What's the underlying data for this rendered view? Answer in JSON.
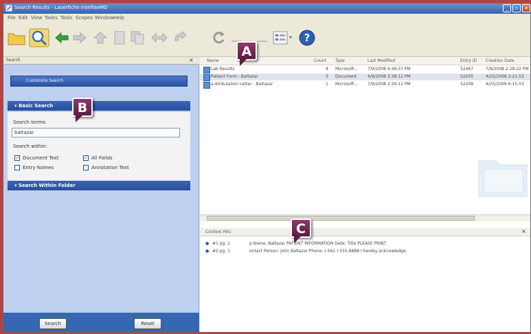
{
  "window": {
    "title": "Search Results - Laserfiche IntelliseMD"
  },
  "menu": [
    "File",
    "Edit",
    "View",
    "Tasks",
    "Tools",
    "Scopes",
    "Window",
    "Help"
  ],
  "search_pane": {
    "header": "Search",
    "customize_label": "Customize Search",
    "basic_search": {
      "title": "Basic Search",
      "terms_label": "Search terms:",
      "terms_value": "baltazar",
      "within_label": "Search within:",
      "options": [
        {
          "label": "Document Text",
          "checked": true
        },
        {
          "label": "All Fields",
          "checked": true
        },
        {
          "label": "Entry Names",
          "checked": false
        },
        {
          "label": "Annotation Text",
          "checked": false
        }
      ]
    },
    "within_folder_title": "Search Within Folder",
    "search_button": "Search",
    "reset_button": "Reset"
  },
  "results": {
    "columns": [
      "Name",
      "Count",
      "Type",
      "Last Modified",
      "Entry ID",
      "Creation Date"
    ],
    "rows": [
      {
        "name": "Lab Results",
        "count": "4",
        "type": "Microsoft...",
        "modified": "7/9/2008 4:49:57 PM",
        "entry_id": "52467",
        "created": "7/9/2008 2:28:22 PM"
      },
      {
        "name": "Patient Form - Baltazar",
        "count": "3",
        "type": "Document",
        "modified": "4/9/2008 3:38:12 PM",
        "entry_id": "52205",
        "created": "4/25/2006 2:21:53"
      },
      {
        "name": "a.Ambulation Letter - Baltazar",
        "count": "1",
        "type": "Microsoft...",
        "modified": "7/9/2008 2:29:11 PM",
        "entry_id": "52208",
        "created": "4/25/2006 6:15:53"
      }
    ]
  },
  "context_hits": {
    "title": "Context Hits",
    "hits": [
      {
        "label": "#1 pg. 1",
        "text": "p Name: Baltazar PATIENT INFORMATION  Date: Title  PLEASE PRINT"
      },
      {
        "label": "#2 pg. 1",
        "text": "ontact Person: John Baltazar  Phone: ( 562 ) 555-8888  I hereby acknowledge"
      }
    ]
  },
  "callouts": [
    "A",
    "B",
    "C"
  ],
  "colors": {
    "background": "#b84040",
    "callout": "#7a2c58",
    "pane": "#bdd0ef",
    "section": "#2a4f9c"
  }
}
